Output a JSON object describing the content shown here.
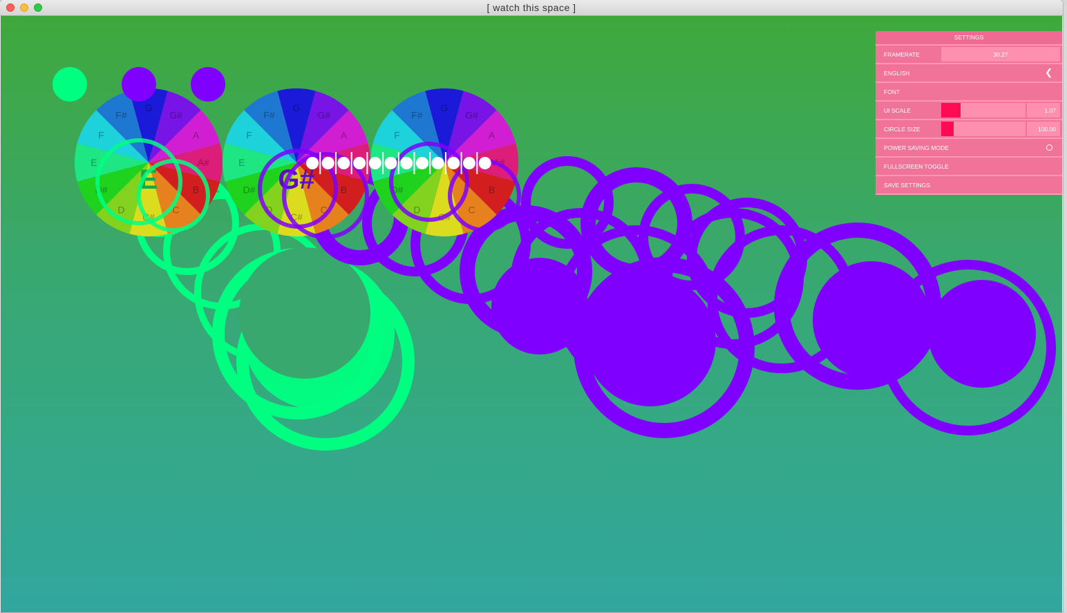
{
  "window": {
    "title": "[  watch  this  space  ]"
  },
  "settings": {
    "header": "SETTINGS",
    "framerate": {
      "label": "FRAMERATE",
      "value": "30.27"
    },
    "language": {
      "label": "ENGLISH"
    },
    "font": {
      "label": "FONT"
    },
    "ui_scale": {
      "label": "UI SCALE",
      "value": "1.07",
      "level": 0.23
    },
    "circle_size": {
      "label": "CIRCLE SIZE",
      "value": "100.00",
      "level": 0.15
    },
    "power_saving": {
      "label": "POWER SAVING MODE",
      "enabled": false
    },
    "fullscreen": {
      "label": "FULLSCREEN TOGGLE"
    },
    "save": {
      "label": "SAVE SETTINGS"
    }
  },
  "visualizer": {
    "note_wheel": [
      "G",
      "G#",
      "A",
      "A#",
      "B",
      "C",
      "C#",
      "D",
      "D#",
      "E",
      "F",
      "F#"
    ],
    "wheel_colors": [
      "#1a1ad8",
      "#7814e6",
      "#d21ed2",
      "#dc1e7a",
      "#d21e1e",
      "#e6821e",
      "#dcdc1e",
      "#82d21e",
      "#1ed21e",
      "#1ee682",
      "#1ed2dc",
      "#1e78d2"
    ],
    "detected_notes": [
      "E",
      "G#"
    ],
    "markers": [
      "#00ff80",
      "#8000ff",
      "#8000ff"
    ],
    "trail_colors": {
      "green": "#00ff80",
      "purple": "#8000ff"
    }
  }
}
